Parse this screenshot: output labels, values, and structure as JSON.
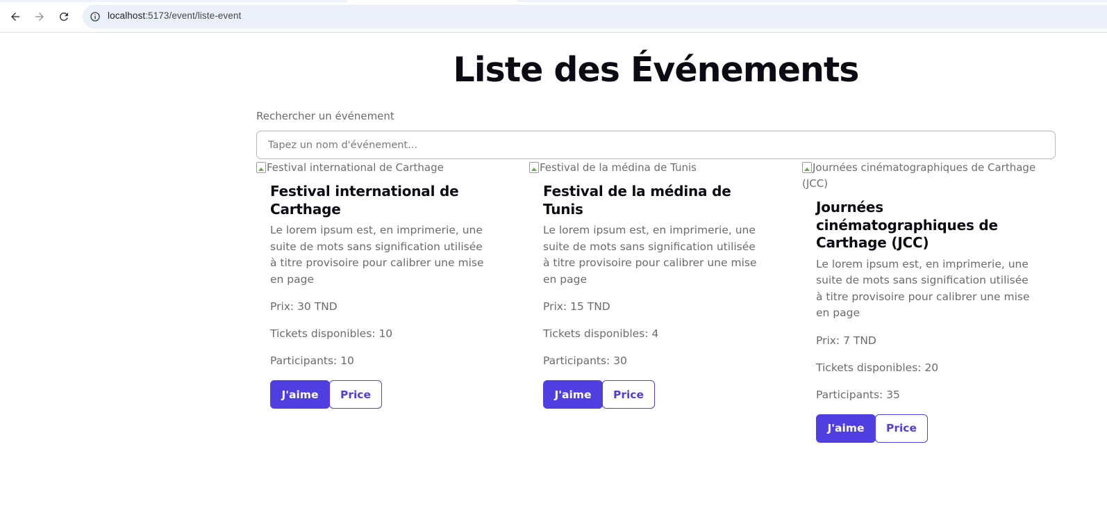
{
  "browser": {
    "url_host": "localhost",
    "url_rest": ":5173/event/liste-event"
  },
  "page": {
    "title": "Liste des Événements",
    "search_label": "Rechercher un événement",
    "search_placeholder": "Tapez un nom d'événement..."
  },
  "events": [
    {
      "image_alt": "Festival international de Carthage",
      "title": "Festival international de Carthage",
      "description": "Le lorem ipsum est, en imprimerie, une suite de mots sans signification utilisée à titre provisoire pour calibrer une mise en page",
      "price": "Prix: 30 TND",
      "tickets": "Tickets disponibles: 10",
      "participants": "Participants: 10",
      "like_label": "J'aime",
      "price_label": "Price"
    },
    {
      "image_alt": "Festival de la médina de Tunis",
      "title": "Festival de la médina de Tunis",
      "description": "Le lorem ipsum est, en imprimerie, une suite de mots sans signification utilisée à titre provisoire pour calibrer une mise en page",
      "price": "Prix: 15 TND",
      "tickets": "Tickets disponibles: 4",
      "participants": "Participants: 30",
      "like_label": "J'aime",
      "price_label": "Price"
    },
    {
      "image_alt": "Journées cinématographiques de Carthage (JCC)",
      "title": "Journées cinématographiques de Carthage (JCC)",
      "description": "Le lorem ipsum est, en imprimerie, une suite de mots sans signification utilisée à titre provisoire pour calibrer une mise en page",
      "price": "Prix: 7 TND",
      "tickets": "Tickets disponibles: 20",
      "participants": "Participants: 35",
      "like_label": "J'aime",
      "price_label": "Price"
    }
  ],
  "colors": {
    "accent": "#4f3ee0",
    "title": "#0b0b14",
    "muted_text": "#6b6b6b"
  },
  "icons": [
    "back-arrow-icon",
    "forward-arrow-icon",
    "reload-icon",
    "site-info-icon",
    "broken-image-icon"
  ]
}
